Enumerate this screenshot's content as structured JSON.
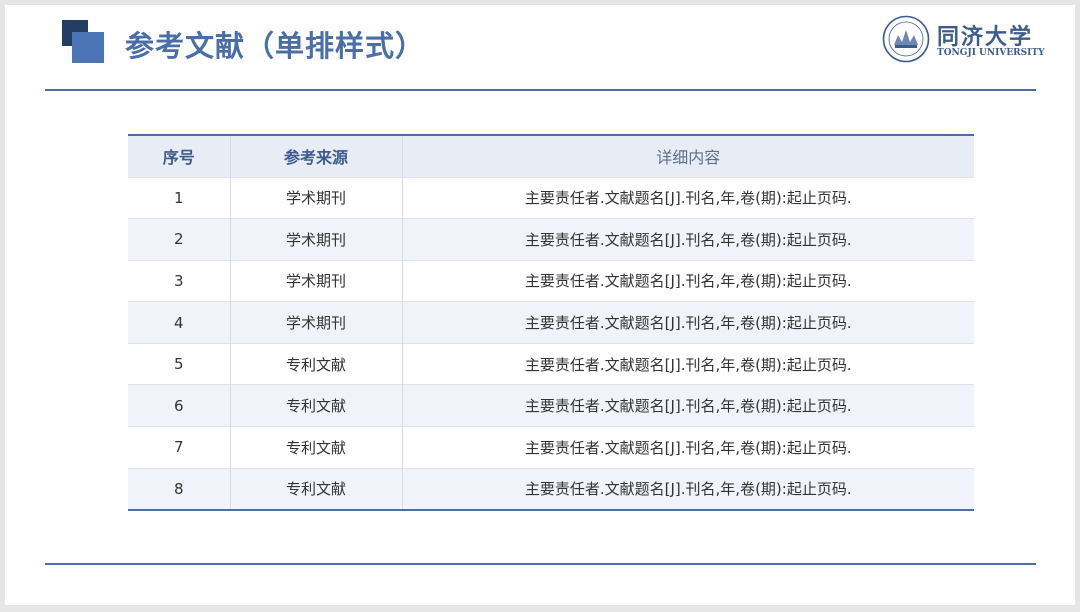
{
  "slide": {
    "title": "参考文献（单排样式）",
    "logo": {
      "name_cn": "同济大学",
      "name_en": "TONGJI UNIVERSITY"
    }
  },
  "table": {
    "headers": [
      "序号",
      "参考来源",
      "详细内容"
    ],
    "rows": [
      [
        "1",
        "学术期刊",
        "主要责任者.文献题名[J].刊名,年,卷(期):起止页码."
      ],
      [
        "2",
        "学术期刊",
        "主要责任者.文献题名[J].刊名,年,卷(期):起止页码."
      ],
      [
        "3",
        "学术期刊",
        "主要责任者.文献题名[J].刊名,年,卷(期):起止页码."
      ],
      [
        "4",
        "学术期刊",
        "主要责任者.文献题名[J].刊名,年,卷(期):起止页码."
      ],
      [
        "5",
        "专利文献",
        "主要责任者.文献题名[J].刊名,年,卷(期):起止页码."
      ],
      [
        "6",
        "专利文献",
        "主要责任者.文献题名[J].刊名,年,卷(期):起止页码."
      ],
      [
        "7",
        "专利文献",
        "主要责任者.文献题名[J].刊名,年,卷(期):起止页码."
      ],
      [
        "8",
        "专利文献",
        "主要责任者.文献题名[J].刊名,年,卷(期):起止页码."
      ]
    ]
  },
  "colors": {
    "accent": "#4a6fa8",
    "dark_square": "#243d63",
    "blue_square": "#4a74b4",
    "header_bg": "#e8edf5",
    "stripe_bg": "#f0f4fa"
  }
}
